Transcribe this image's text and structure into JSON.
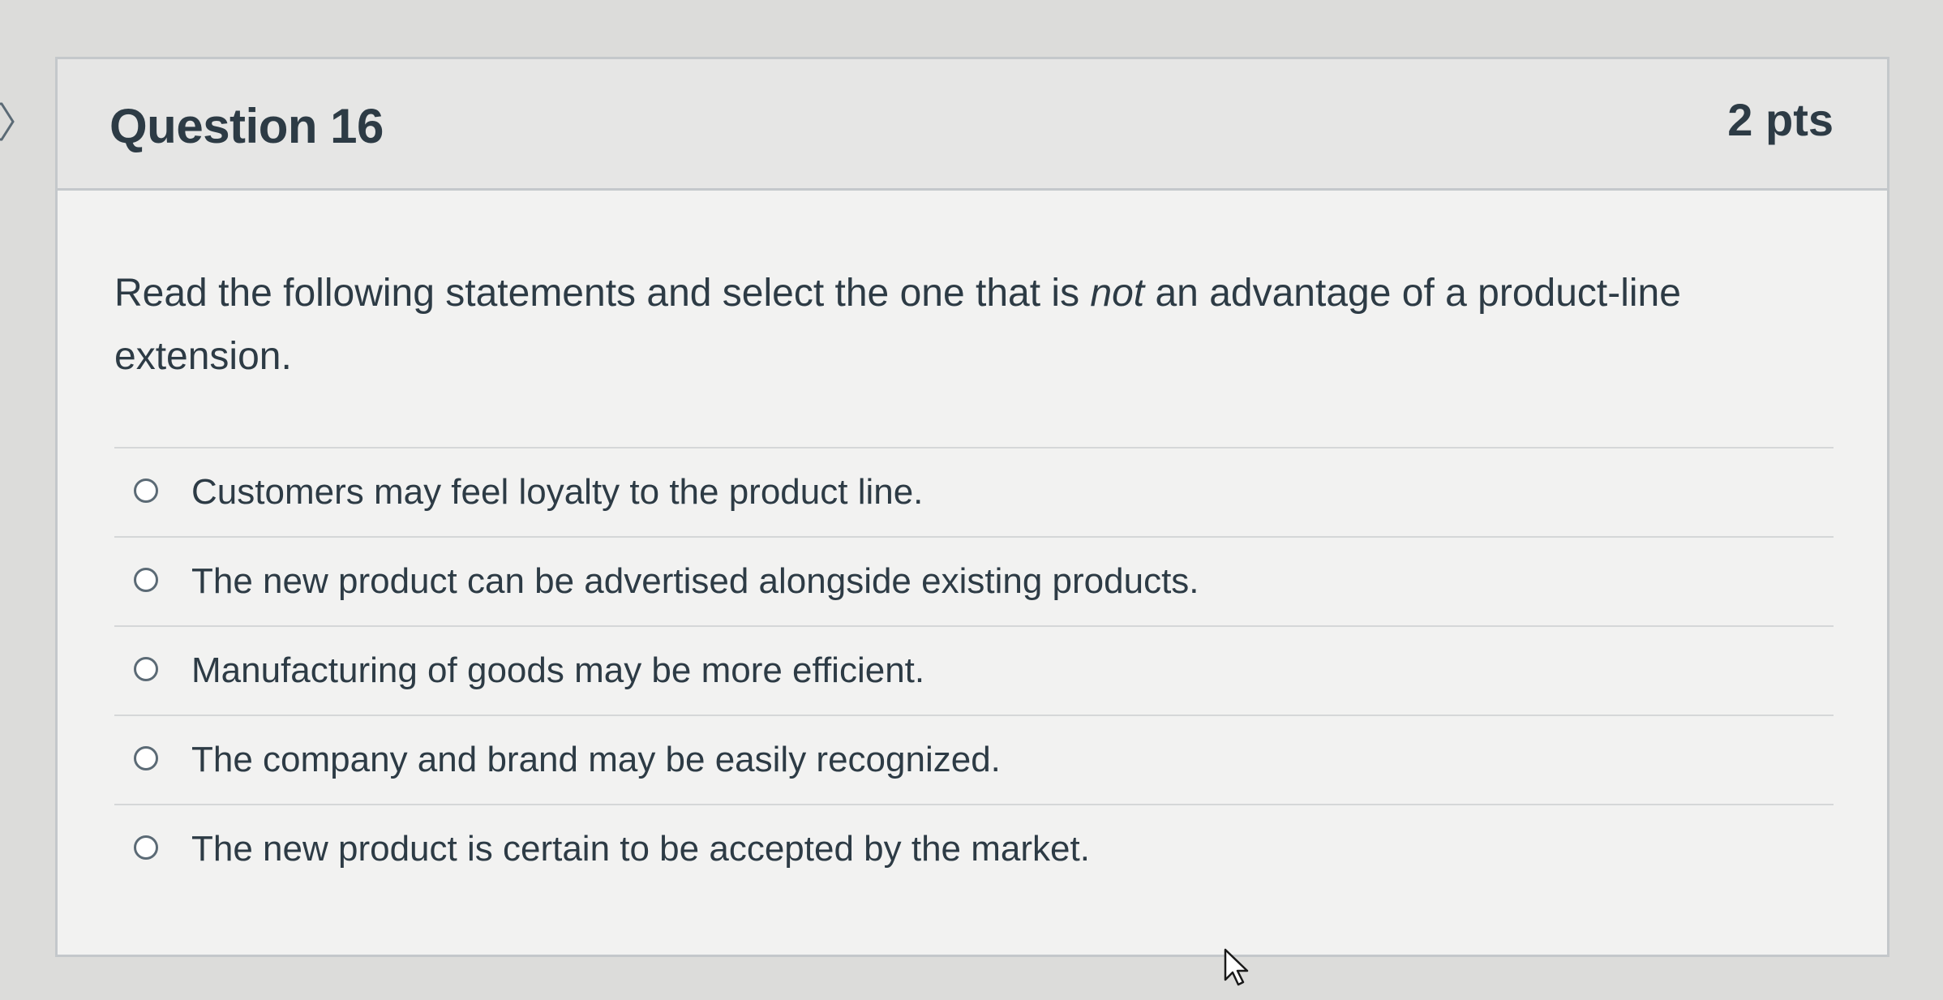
{
  "question": {
    "title": "Question 16",
    "points": "2 pts",
    "text_before": "Read the following statements and select the one that is ",
    "text_emphasis": "not",
    "text_after": " an advantage of a product-line extension."
  },
  "answers": [
    {
      "label": "Customers may feel loyalty to the product line.",
      "selected": false
    },
    {
      "label": "The new product can be advertised alongside existing products.",
      "selected": false
    },
    {
      "label": "Manufacturing of goods may be more efficient.",
      "selected": false
    },
    {
      "label": "The company and brand may be easily recognized.",
      "selected": false
    },
    {
      "label": "The new product is certain to be accepted by the market.",
      "selected": false
    }
  ],
  "icons": {
    "nav": "chevron-right-icon",
    "radio": "radio-unchecked-icon",
    "cursor": "mouse-pointer-icon"
  },
  "colors": {
    "text": "#2d3b45",
    "header_bg": "#e6e6e5",
    "card_bg": "#f2f2f1",
    "border": "#c4c8cb"
  }
}
